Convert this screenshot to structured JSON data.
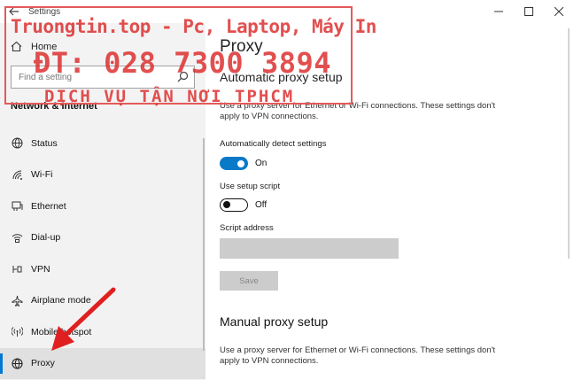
{
  "window": {
    "title": "Settings",
    "back_icon": "back-arrow-icon",
    "controls": [
      "minimize-icon",
      "maximize-icon",
      "close-icon"
    ]
  },
  "sidebar": {
    "home_label": "Home",
    "search_placeholder": "Find a setting",
    "section_title": "Network & Internet",
    "items": [
      {
        "label": "Status",
        "icon": "globe-status-icon"
      },
      {
        "label": "Wi-Fi",
        "icon": "wifi-icon"
      },
      {
        "label": "Ethernet",
        "icon": "ethernet-icon"
      },
      {
        "label": "Dial-up",
        "icon": "dialup-icon"
      },
      {
        "label": "VPN",
        "icon": "vpn-icon"
      },
      {
        "label": "Airplane mode",
        "icon": "airplane-icon"
      },
      {
        "label": "Mobile hotspot",
        "icon": "hotspot-icon"
      },
      {
        "label": "Proxy",
        "icon": "globe-icon",
        "active": true
      }
    ]
  },
  "main": {
    "title": "Proxy",
    "auto_heading": "Automatic proxy setup",
    "auto_desc": "Use a proxy server for Ethernet or Wi-Fi connections. These settings don't apply to VPN connections.",
    "auto_detect_label": "Automatically detect settings",
    "auto_detect_state": "On",
    "setup_script_label": "Use setup script",
    "setup_script_state": "Off",
    "script_address_label": "Script address",
    "script_address_value": "",
    "save_label": "Save",
    "manual_heading": "Manual proxy setup",
    "manual_desc": "Use a proxy server for Ethernet or Wi-Fi connections. These settings don't apply to VPN connections."
  },
  "watermark": {
    "line1": "Truongtin.top - Pc, Laptop, Máy In",
    "line2": "ĐT: 028 7300 3894",
    "line3": "DỊCH VỤ TẬN NƠI TPHCM"
  },
  "colors": {
    "accent": "#0078d4",
    "toggle_on": "#0a7ac8",
    "watermark": "#dc2828",
    "arrow": "#e02020"
  }
}
